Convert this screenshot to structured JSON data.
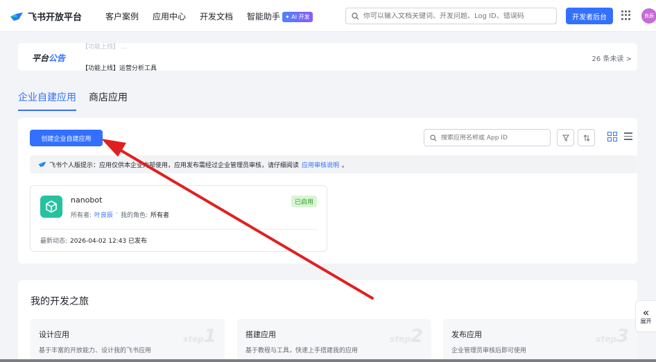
{
  "header": {
    "logo_text": "飞书开放平台",
    "nav": [
      "客户案例",
      "应用中心",
      "开发文档",
      "智能助手"
    ],
    "ai_badge": "✦ AI 开发",
    "search_placeholder": "你可以输入文档关键词、开发问题、Log ID、错误码",
    "dev_button": "开发者后台",
    "avatar_text": "良辰"
  },
  "notice": {
    "title_a": "平台",
    "title_b": "公告",
    "faded_item": "【功能上线】 ...",
    "item": "【功能上线】运营分析工具",
    "unread": "26 条未读 >"
  },
  "tabs": [
    {
      "label": "企业自建应用",
      "active": true
    },
    {
      "label": "商店应用",
      "active": false
    }
  ],
  "panel": {
    "create_button": "创建企业自建应用",
    "search_placeholder": "搜索应用名称或 App ID",
    "tip_prefix": "飞书个人版提示：应用仅供本企业内部使用，应用发布需经过企业管理员审核，请仔细阅读",
    "tip_link": "应用审核说明",
    "tip_suffix": "。"
  },
  "app": {
    "name": "nanobot",
    "status": "已启用",
    "owner_label": "所有者:",
    "owner": "叶良辰",
    "sep": "·",
    "role_label": "我的角色:",
    "role": "所有者",
    "activity_label": "最新动态:",
    "activity": "2026-04-02 12:43 已发布"
  },
  "journey": {
    "title": "我的开发之旅",
    "steps": [
      {
        "title": "设计应用",
        "desc": "基于丰富的开放能力、设计我的飞书应用",
        "num": "1"
      },
      {
        "title": "搭建应用",
        "desc": "基于教程与工具，快速上手搭建我的应用",
        "num": "2"
      },
      {
        "title": "发布应用",
        "desc": "企业管理员审核后即可使用",
        "num": "3"
      }
    ],
    "step_word": "step"
  },
  "expand": {
    "label": "展开"
  },
  "colors": {
    "accent": "#3370ff",
    "arrow": "#e02020"
  }
}
